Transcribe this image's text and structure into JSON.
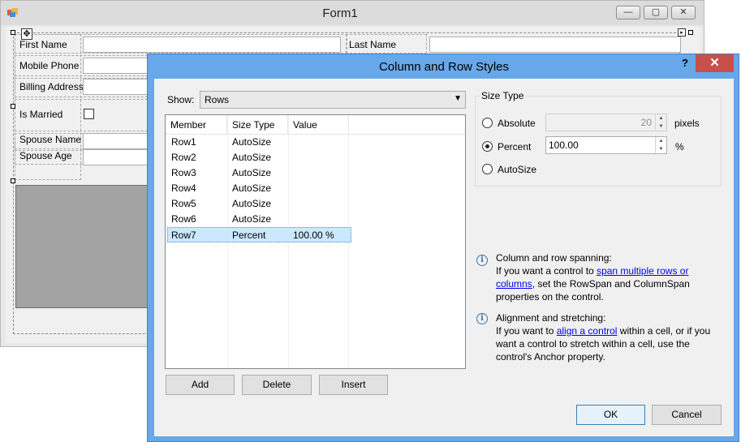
{
  "form1": {
    "title": "Form1",
    "min_label": "—",
    "max_label": "▢",
    "close_label": "✕",
    "labels": [
      "First Name",
      "Mobile Phone",
      "Billing Address",
      "Is Married",
      "Spouse Name",
      "Spouse Age",
      "Last Name"
    ]
  },
  "dialog": {
    "title": "Column and Row Styles",
    "help_label": "?",
    "close_label": "✕",
    "show_label": "Show:",
    "show_value": "Rows",
    "columns": [
      "Member",
      "Size Type",
      "Value"
    ],
    "rows": [
      {
        "member": "Row1",
        "size_type": "AutoSize",
        "value": ""
      },
      {
        "member": "Row2",
        "size_type": "AutoSize",
        "value": ""
      },
      {
        "member": "Row3",
        "size_type": "AutoSize",
        "value": ""
      },
      {
        "member": "Row4",
        "size_type": "AutoSize",
        "value": ""
      },
      {
        "member": "Row5",
        "size_type": "AutoSize",
        "value": ""
      },
      {
        "member": "Row6",
        "size_type": "AutoSize",
        "value": ""
      },
      {
        "member": "Row7",
        "size_type": "Percent",
        "value": "100.00 %"
      }
    ],
    "buttons": {
      "add": "Add",
      "delete": "Delete",
      "insert": "Insert",
      "ok": "OK",
      "cancel": "Cancel"
    },
    "size_type": {
      "group_label": "Size Type",
      "absolute_label": "Absolute",
      "absolute_value": "20",
      "absolute_unit": "pixels",
      "percent_label": "Percent",
      "percent_value": "100.00",
      "percent_unit": "%",
      "autosize_label": "AutoSize",
      "selected": "Percent"
    },
    "info": {
      "spanning_title": "Column and row spanning:",
      "spanning_pre": "If you want a control to ",
      "spanning_link": "span multiple rows or columns",
      "spanning_post": ", set the RowSpan and ColumnSpan properties on the control.",
      "align_title": "Alignment and stretching:",
      "align_pre": "If you want to ",
      "align_link": "align a control",
      "align_post": " within a cell, or if you want a control to stretch within a cell, use the control's Anchor property."
    }
  }
}
